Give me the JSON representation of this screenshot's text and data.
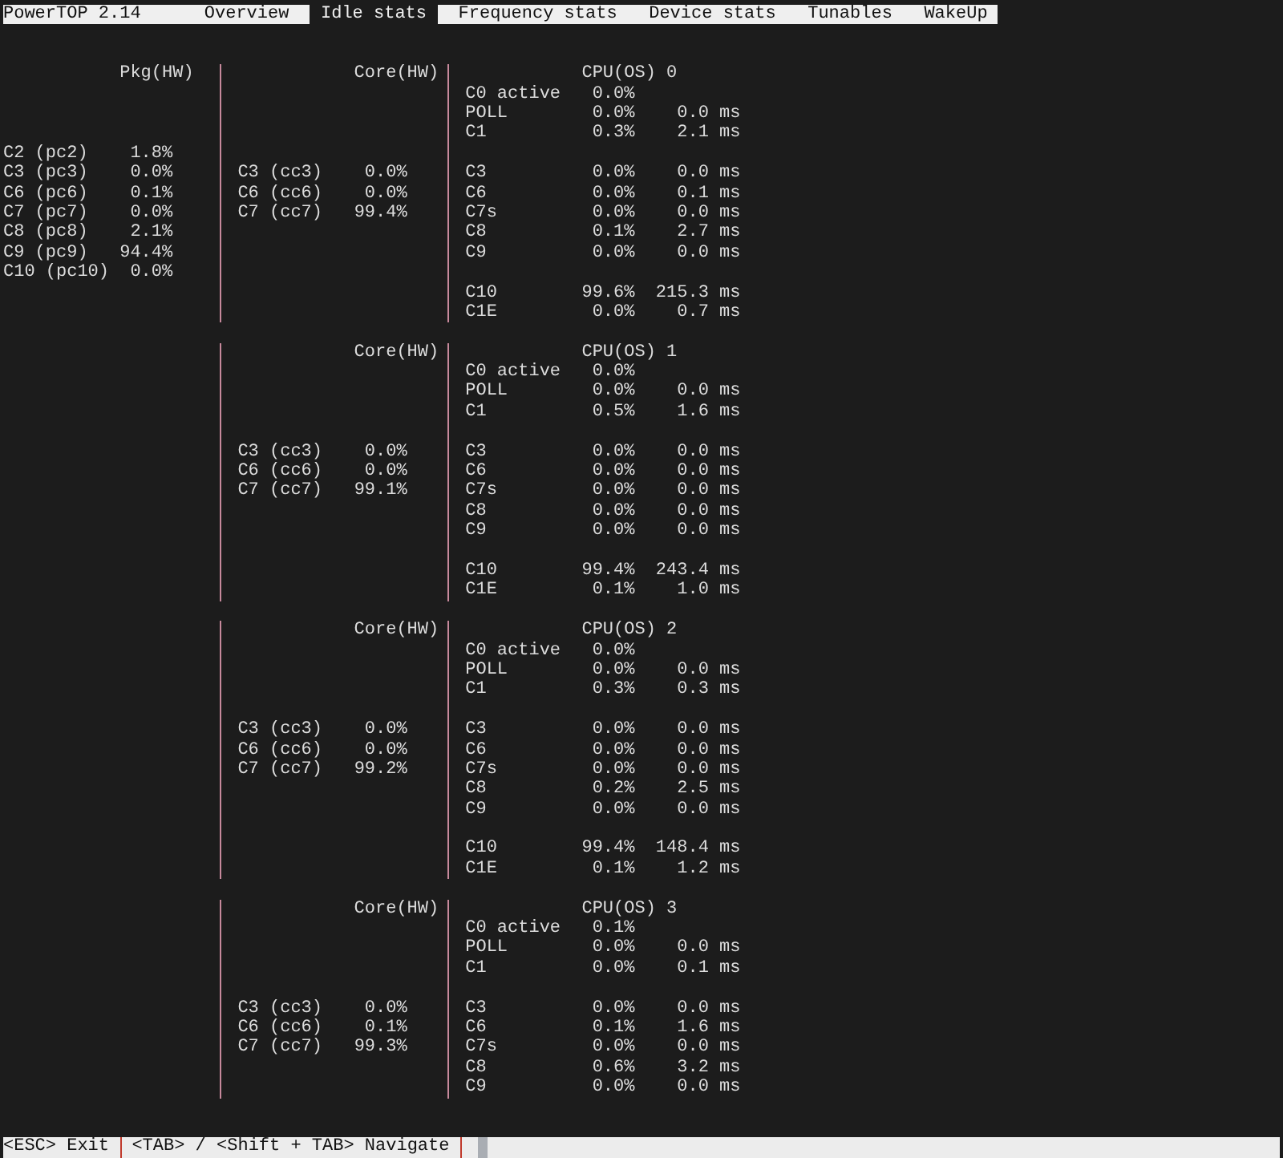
{
  "header": {
    "title": "PowerTOP 2.14",
    "tabs": [
      {
        "label": "Overview",
        "selected": false
      },
      {
        "label": "Idle stats",
        "selected": true
      },
      {
        "label": "Frequency stats",
        "selected": false
      },
      {
        "label": "Device stats",
        "selected": false
      },
      {
        "label": "Tunables",
        "selected": false
      },
      {
        "label": "WakeUp",
        "selected": false
      }
    ]
  },
  "package": {
    "heading": "Pkg(HW)",
    "states": [
      {
        "name": "C2 (pc2)",
        "percent": "1.8%"
      },
      {
        "name": "C3 (pc3)",
        "percent": "0.0%"
      },
      {
        "name": "C6 (pc6)",
        "percent": "0.1%"
      },
      {
        "name": "C7 (pc7)",
        "percent": "0.0%"
      },
      {
        "name": "C8 (pc8)",
        "percent": "2.1%"
      },
      {
        "name": "C9 (pc9)",
        "percent": "94.4%"
      },
      {
        "name": "C10 (pc10)",
        "percent": "0.0%"
      }
    ]
  },
  "cpus": [
    {
      "core": {
        "heading": "Core(HW)",
        "states": [
          {
            "name": "C3 (cc3)",
            "percent": "0.0%"
          },
          {
            "name": "C6 (cc6)",
            "percent": "0.0%"
          },
          {
            "name": "C7 (cc7)",
            "percent": "99.4%"
          }
        ]
      },
      "cpu": {
        "heading": "CPU(OS) 0",
        "groups": [
          {
            "states": [
              {
                "name": "C0 active",
                "percent": "0.0%"
              },
              {
                "name": "POLL",
                "percent": "0.0%",
                "time": "0.0 ms"
              },
              {
                "name": "C1",
                "percent": "0.3%",
                "time": "2.1 ms"
              }
            ]
          },
          {
            "states": [
              {
                "name": "C3",
                "percent": "0.0%",
                "time": "0.0 ms"
              },
              {
                "name": "C6",
                "percent": "0.0%",
                "time": "0.1 ms"
              },
              {
                "name": "C7s",
                "percent": "0.0%",
                "time": "0.0 ms"
              },
              {
                "name": "C8",
                "percent": "0.1%",
                "time": "2.7 ms"
              },
              {
                "name": "C9",
                "percent": "0.0%",
                "time": "0.0 ms"
              }
            ]
          },
          {
            "states": [
              {
                "name": "C10",
                "percent": "99.6%",
                "time": "215.3 ms"
              },
              {
                "name": "C1E",
                "percent": "0.0%",
                "time": "0.7 ms"
              }
            ]
          }
        ]
      }
    },
    {
      "core": {
        "heading": "Core(HW)",
        "states": [
          {
            "name": "C3 (cc3)",
            "percent": "0.0%"
          },
          {
            "name": "C6 (cc6)",
            "percent": "0.0%"
          },
          {
            "name": "C7 (cc7)",
            "percent": "99.1%"
          }
        ]
      },
      "cpu": {
        "heading": "CPU(OS) 1",
        "groups": [
          {
            "states": [
              {
                "name": "C0 active",
                "percent": "0.0%"
              },
              {
                "name": "POLL",
                "percent": "0.0%",
                "time": "0.0 ms"
              },
              {
                "name": "C1",
                "percent": "0.5%",
                "time": "1.6 ms"
              }
            ]
          },
          {
            "states": [
              {
                "name": "C3",
                "percent": "0.0%",
                "time": "0.0 ms"
              },
              {
                "name": "C6",
                "percent": "0.0%",
                "time": "0.0 ms"
              },
              {
                "name": "C7s",
                "percent": "0.0%",
                "time": "0.0 ms"
              },
              {
                "name": "C8",
                "percent": "0.0%",
                "time": "0.0 ms"
              },
              {
                "name": "C9",
                "percent": "0.0%",
                "time": "0.0 ms"
              }
            ]
          },
          {
            "states": [
              {
                "name": "C10",
                "percent": "99.4%",
                "time": "243.4 ms"
              },
              {
                "name": "C1E",
                "percent": "0.1%",
                "time": "1.0 ms"
              }
            ]
          }
        ]
      }
    },
    {
      "core": {
        "heading": "Core(HW)",
        "states": [
          {
            "name": "C3 (cc3)",
            "percent": "0.0%"
          },
          {
            "name": "C6 (cc6)",
            "percent": "0.0%"
          },
          {
            "name": "C7 (cc7)",
            "percent": "99.2%"
          }
        ]
      },
      "cpu": {
        "heading": "CPU(OS) 2",
        "groups": [
          {
            "states": [
              {
                "name": "C0 active",
                "percent": "0.0%"
              },
              {
                "name": "POLL",
                "percent": "0.0%",
                "time": "0.0 ms"
              },
              {
                "name": "C1",
                "percent": "0.3%",
                "time": "0.3 ms"
              }
            ]
          },
          {
            "states": [
              {
                "name": "C3",
                "percent": "0.0%",
                "time": "0.0 ms"
              },
              {
                "name": "C6",
                "percent": "0.0%",
                "time": "0.0 ms"
              },
              {
                "name": "C7s",
                "percent": "0.0%",
                "time": "0.0 ms"
              },
              {
                "name": "C8",
                "percent": "0.2%",
                "time": "2.5 ms"
              },
              {
                "name": "C9",
                "percent": "0.0%",
                "time": "0.0 ms"
              }
            ]
          },
          {
            "states": [
              {
                "name": "C10",
                "percent": "99.4%",
                "time": "148.4 ms"
              },
              {
                "name": "C1E",
                "percent": "0.1%",
                "time": "1.2 ms"
              }
            ]
          }
        ]
      }
    },
    {
      "core": {
        "heading": "Core(HW)",
        "states": [
          {
            "name": "C3 (cc3)",
            "percent": "0.0%"
          },
          {
            "name": "C6 (cc6)",
            "percent": "0.1%"
          },
          {
            "name": "C7 (cc7)",
            "percent": "99.3%"
          }
        ]
      },
      "cpu": {
        "heading": "CPU(OS) 3",
        "groups": [
          {
            "states": [
              {
                "name": "C0 active",
                "percent": "0.1%"
              },
              {
                "name": "POLL",
                "percent": "0.0%",
                "time": "0.0 ms"
              },
              {
                "name": "C1",
                "percent": "0.0%",
                "time": "0.1 ms"
              }
            ]
          },
          {
            "states": [
              {
                "name": "C3",
                "percent": "0.0%",
                "time": "0.0 ms"
              },
              {
                "name": "C6",
                "percent": "0.1%",
                "time": "1.6 ms"
              },
              {
                "name": "C7s",
                "percent": "0.0%",
                "time": "0.0 ms"
              },
              {
                "name": "C8",
                "percent": "0.6%",
                "time": "3.2 ms"
              },
              {
                "name": "C9",
                "percent": "0.0%",
                "time": "0.0 ms"
              }
            ]
          }
        ]
      }
    }
  ],
  "footer": {
    "hints": [
      "<ESC> Exit",
      "<TAB> / <Shift + TAB> Navigate"
    ]
  }
}
